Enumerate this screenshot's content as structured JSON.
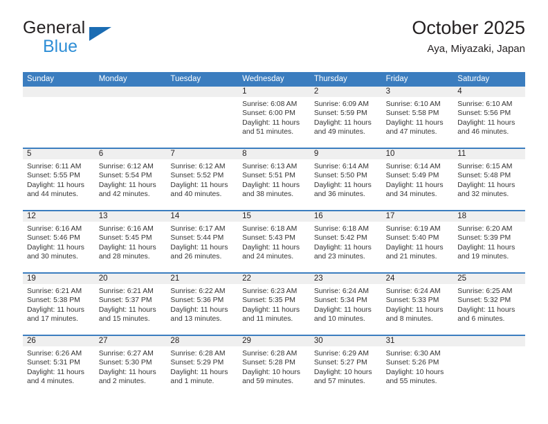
{
  "brand": {
    "name_top": "General",
    "name_bottom": "Blue",
    "accent_dark": "#1b6cb3",
    "accent_light": "#2e8ed6"
  },
  "header": {
    "title": "October 2025",
    "subtitle": "Aya, Miyazaki, Japan"
  },
  "theme": {
    "header_blue": "#3b7dbf",
    "day_band_gray": "#efefef",
    "text": "#231f20"
  },
  "weekdays": [
    "Sunday",
    "Monday",
    "Tuesday",
    "Wednesday",
    "Thursday",
    "Friday",
    "Saturday"
  ],
  "weeks": [
    [
      {
        "day": "",
        "sunrise": "",
        "sunset": "",
        "daylight_line1": "",
        "daylight_line2": ""
      },
      {
        "day": "",
        "sunrise": "",
        "sunset": "",
        "daylight_line1": "",
        "daylight_line2": ""
      },
      {
        "day": "",
        "sunrise": "",
        "sunset": "",
        "daylight_line1": "",
        "daylight_line2": ""
      },
      {
        "day": "1",
        "sunrise": "Sunrise: 6:08 AM",
        "sunset": "Sunset: 6:00 PM",
        "daylight_line1": "Daylight: 11 hours",
        "daylight_line2": "and 51 minutes."
      },
      {
        "day": "2",
        "sunrise": "Sunrise: 6:09 AM",
        "sunset": "Sunset: 5:59 PM",
        "daylight_line1": "Daylight: 11 hours",
        "daylight_line2": "and 49 minutes."
      },
      {
        "day": "3",
        "sunrise": "Sunrise: 6:10 AM",
        "sunset": "Sunset: 5:58 PM",
        "daylight_line1": "Daylight: 11 hours",
        "daylight_line2": "and 47 minutes."
      },
      {
        "day": "4",
        "sunrise": "Sunrise: 6:10 AM",
        "sunset": "Sunset: 5:56 PM",
        "daylight_line1": "Daylight: 11 hours",
        "daylight_line2": "and 46 minutes."
      }
    ],
    [
      {
        "day": "5",
        "sunrise": "Sunrise: 6:11 AM",
        "sunset": "Sunset: 5:55 PM",
        "daylight_line1": "Daylight: 11 hours",
        "daylight_line2": "and 44 minutes."
      },
      {
        "day": "6",
        "sunrise": "Sunrise: 6:12 AM",
        "sunset": "Sunset: 5:54 PM",
        "daylight_line1": "Daylight: 11 hours",
        "daylight_line2": "and 42 minutes."
      },
      {
        "day": "7",
        "sunrise": "Sunrise: 6:12 AM",
        "sunset": "Sunset: 5:52 PM",
        "daylight_line1": "Daylight: 11 hours",
        "daylight_line2": "and 40 minutes."
      },
      {
        "day": "8",
        "sunrise": "Sunrise: 6:13 AM",
        "sunset": "Sunset: 5:51 PM",
        "daylight_line1": "Daylight: 11 hours",
        "daylight_line2": "and 38 minutes."
      },
      {
        "day": "9",
        "sunrise": "Sunrise: 6:14 AM",
        "sunset": "Sunset: 5:50 PM",
        "daylight_line1": "Daylight: 11 hours",
        "daylight_line2": "and 36 minutes."
      },
      {
        "day": "10",
        "sunrise": "Sunrise: 6:14 AM",
        "sunset": "Sunset: 5:49 PM",
        "daylight_line1": "Daylight: 11 hours",
        "daylight_line2": "and 34 minutes."
      },
      {
        "day": "11",
        "sunrise": "Sunrise: 6:15 AM",
        "sunset": "Sunset: 5:48 PM",
        "daylight_line1": "Daylight: 11 hours",
        "daylight_line2": "and 32 minutes."
      }
    ],
    [
      {
        "day": "12",
        "sunrise": "Sunrise: 6:16 AM",
        "sunset": "Sunset: 5:46 PM",
        "daylight_line1": "Daylight: 11 hours",
        "daylight_line2": "and 30 minutes."
      },
      {
        "day": "13",
        "sunrise": "Sunrise: 6:16 AM",
        "sunset": "Sunset: 5:45 PM",
        "daylight_line1": "Daylight: 11 hours",
        "daylight_line2": "and 28 minutes."
      },
      {
        "day": "14",
        "sunrise": "Sunrise: 6:17 AM",
        "sunset": "Sunset: 5:44 PM",
        "daylight_line1": "Daylight: 11 hours",
        "daylight_line2": "and 26 minutes."
      },
      {
        "day": "15",
        "sunrise": "Sunrise: 6:18 AM",
        "sunset": "Sunset: 5:43 PM",
        "daylight_line1": "Daylight: 11 hours",
        "daylight_line2": "and 24 minutes."
      },
      {
        "day": "16",
        "sunrise": "Sunrise: 6:18 AM",
        "sunset": "Sunset: 5:42 PM",
        "daylight_line1": "Daylight: 11 hours",
        "daylight_line2": "and 23 minutes."
      },
      {
        "day": "17",
        "sunrise": "Sunrise: 6:19 AM",
        "sunset": "Sunset: 5:40 PM",
        "daylight_line1": "Daylight: 11 hours",
        "daylight_line2": "and 21 minutes."
      },
      {
        "day": "18",
        "sunrise": "Sunrise: 6:20 AM",
        "sunset": "Sunset: 5:39 PM",
        "daylight_line1": "Daylight: 11 hours",
        "daylight_line2": "and 19 minutes."
      }
    ],
    [
      {
        "day": "19",
        "sunrise": "Sunrise: 6:21 AM",
        "sunset": "Sunset: 5:38 PM",
        "daylight_line1": "Daylight: 11 hours",
        "daylight_line2": "and 17 minutes."
      },
      {
        "day": "20",
        "sunrise": "Sunrise: 6:21 AM",
        "sunset": "Sunset: 5:37 PM",
        "daylight_line1": "Daylight: 11 hours",
        "daylight_line2": "and 15 minutes."
      },
      {
        "day": "21",
        "sunrise": "Sunrise: 6:22 AM",
        "sunset": "Sunset: 5:36 PM",
        "daylight_line1": "Daylight: 11 hours",
        "daylight_line2": "and 13 minutes."
      },
      {
        "day": "22",
        "sunrise": "Sunrise: 6:23 AM",
        "sunset": "Sunset: 5:35 PM",
        "daylight_line1": "Daylight: 11 hours",
        "daylight_line2": "and 11 minutes."
      },
      {
        "day": "23",
        "sunrise": "Sunrise: 6:24 AM",
        "sunset": "Sunset: 5:34 PM",
        "daylight_line1": "Daylight: 11 hours",
        "daylight_line2": "and 10 minutes."
      },
      {
        "day": "24",
        "sunrise": "Sunrise: 6:24 AM",
        "sunset": "Sunset: 5:33 PM",
        "daylight_line1": "Daylight: 11 hours",
        "daylight_line2": "and 8 minutes."
      },
      {
        "day": "25",
        "sunrise": "Sunrise: 6:25 AM",
        "sunset": "Sunset: 5:32 PM",
        "daylight_line1": "Daylight: 11 hours",
        "daylight_line2": "and 6 minutes."
      }
    ],
    [
      {
        "day": "26",
        "sunrise": "Sunrise: 6:26 AM",
        "sunset": "Sunset: 5:31 PM",
        "daylight_line1": "Daylight: 11 hours",
        "daylight_line2": "and 4 minutes."
      },
      {
        "day": "27",
        "sunrise": "Sunrise: 6:27 AM",
        "sunset": "Sunset: 5:30 PM",
        "daylight_line1": "Daylight: 11 hours",
        "daylight_line2": "and 2 minutes."
      },
      {
        "day": "28",
        "sunrise": "Sunrise: 6:28 AM",
        "sunset": "Sunset: 5:29 PM",
        "daylight_line1": "Daylight: 11 hours",
        "daylight_line2": "and 1 minute."
      },
      {
        "day": "29",
        "sunrise": "Sunrise: 6:28 AM",
        "sunset": "Sunset: 5:28 PM",
        "daylight_line1": "Daylight: 10 hours",
        "daylight_line2": "and 59 minutes."
      },
      {
        "day": "30",
        "sunrise": "Sunrise: 6:29 AM",
        "sunset": "Sunset: 5:27 PM",
        "daylight_line1": "Daylight: 10 hours",
        "daylight_line2": "and 57 minutes."
      },
      {
        "day": "31",
        "sunrise": "Sunrise: 6:30 AM",
        "sunset": "Sunset: 5:26 PM",
        "daylight_line1": "Daylight: 10 hours",
        "daylight_line2": "and 55 minutes."
      },
      {
        "day": "",
        "sunrise": "",
        "sunset": "",
        "daylight_line1": "",
        "daylight_line2": ""
      }
    ]
  ]
}
